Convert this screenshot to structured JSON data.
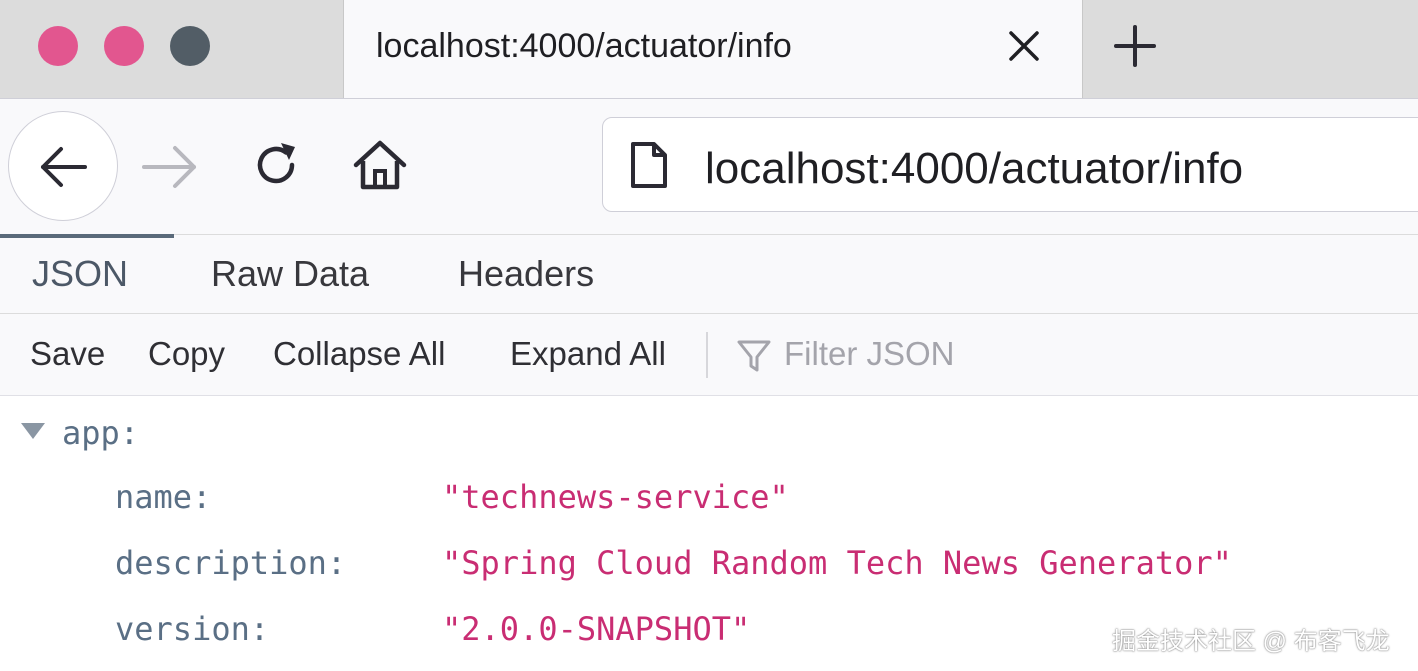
{
  "browser": {
    "tab": {
      "title": "localhost:4000/actuator/info"
    },
    "address_bar": {
      "url": "localhost:4000/actuator/info"
    }
  },
  "viewer": {
    "tabs": [
      {
        "label": "JSON",
        "active": true
      },
      {
        "label": "Raw Data",
        "active": false
      },
      {
        "label": "Headers",
        "active": false
      }
    ],
    "actions": {
      "save": "Save",
      "copy": "Copy",
      "collapse_all": "Collapse All",
      "expand_all": "Expand All"
    },
    "filter": {
      "placeholder": "Filter JSON",
      "icon": "funnel-icon"
    }
  },
  "json_tree": {
    "root_key": "app:",
    "expanded": true,
    "rows": [
      {
        "key": "name:",
        "value": "\"technews-service\""
      },
      {
        "key": "description:",
        "value": "\"Spring Cloud Random Tech News Generator\""
      },
      {
        "key": "version:",
        "value": "\"2.0.0-SNAPSHOT\""
      }
    ]
  },
  "watermark": "掘金技术社区 @ 布客飞龙",
  "colors": {
    "traffic_close": "#e2568f",
    "traffic_minimize": "#e2568f",
    "traffic_maximize": "#525d66",
    "json_key": "#5a6f85",
    "json_string": "#c92d73"
  }
}
